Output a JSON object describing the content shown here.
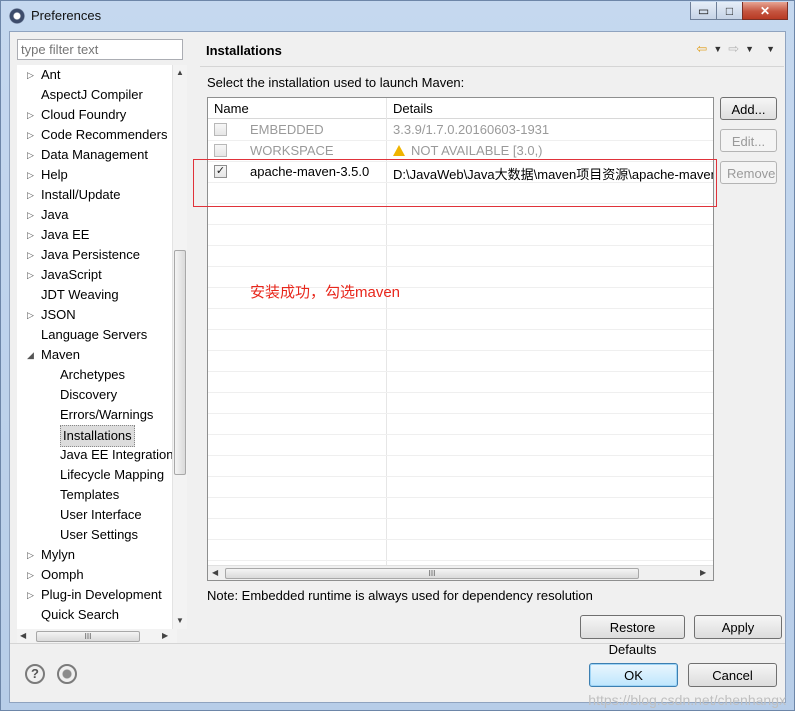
{
  "window": {
    "title": "Preferences",
    "buttons": {
      "minimize": "▭",
      "maximize": "□",
      "close": "✕"
    }
  },
  "sidebar": {
    "filter_placeholder": "type filter text",
    "items": [
      {
        "label": "Ant",
        "expandable": true
      },
      {
        "label": "AspectJ Compiler",
        "expandable": false
      },
      {
        "label": "Cloud Foundry",
        "expandable": true
      },
      {
        "label": "Code Recommenders",
        "expandable": true
      },
      {
        "label": "Data Management",
        "expandable": true
      },
      {
        "label": "Help",
        "expandable": true
      },
      {
        "label": "Install/Update",
        "expandable": true
      },
      {
        "label": "Java",
        "expandable": true
      },
      {
        "label": "Java EE",
        "expandable": true
      },
      {
        "label": "Java Persistence",
        "expandable": true
      },
      {
        "label": "JavaScript",
        "expandable": true
      },
      {
        "label": "JDT Weaving",
        "expandable": false
      },
      {
        "label": "JSON",
        "expandable": true
      },
      {
        "label": "Language Servers",
        "expandable": false
      },
      {
        "label": "Maven",
        "expandable": true,
        "expanded": true
      },
      {
        "label": "Archetypes",
        "child": true
      },
      {
        "label": "Discovery",
        "child": true
      },
      {
        "label": "Errors/Warnings",
        "child": true
      },
      {
        "label": "Installations",
        "child": true,
        "selected": true
      },
      {
        "label": "Java EE Integration",
        "child": true
      },
      {
        "label": "Lifecycle Mapping",
        "child": true
      },
      {
        "label": "Templates",
        "child": true
      },
      {
        "label": "User Interface",
        "child": true
      },
      {
        "label": "User Settings",
        "child": true
      },
      {
        "label": "Mylyn",
        "expandable": true
      },
      {
        "label": "Oomph",
        "expandable": true
      },
      {
        "label": "Plug-in Development",
        "expandable": true
      },
      {
        "label": "Quick Search",
        "expandable": false
      }
    ]
  },
  "page": {
    "title": "Installations",
    "description": "Select the installation used to launch Maven:",
    "columns": {
      "name": "Name",
      "details": "Details"
    },
    "rows": [
      {
        "name": "EMBEDDED",
        "details": "3.3.9/1.7.0.20160603-1931",
        "checked": false,
        "disabled": true,
        "warning": false
      },
      {
        "name": "WORKSPACE",
        "details": "NOT AVAILABLE [3.0,)",
        "checked": false,
        "disabled": true,
        "warning": true
      },
      {
        "name": "apache-maven-3.5.0",
        "details": "D:\\JavaWeb\\Java大数据\\maven项目资源\\apache-maven-",
        "checked": true,
        "disabled": false,
        "warning": false
      }
    ],
    "annotation": "安装成功，勾选maven",
    "buttons": {
      "add": "Add...",
      "edit": "Edit...",
      "remove": "Remove"
    },
    "note": "Note: Embedded runtime is always used for dependency resolution",
    "restore_defaults": "Restore Defaults",
    "apply": "Apply"
  },
  "footer": {
    "help_icon_glyph": "?",
    "ok": "OK",
    "cancel": "Cancel"
  },
  "watermark": "https://blog.csdn.net/chenhangx",
  "colors": {
    "annotation_red": "#e8271c",
    "accent_blue": "#3c7fb1"
  }
}
